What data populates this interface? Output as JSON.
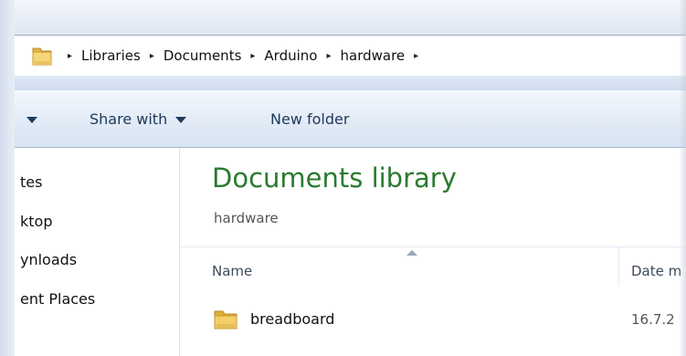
{
  "address_bar": {
    "breadcrumbs": [
      "Libraries",
      "Documents",
      "Arduino",
      "hardware"
    ],
    "separator": "▸"
  },
  "toolbar": {
    "organize_caret": "",
    "share_with_label": "Share with",
    "new_folder_label": "New folder"
  },
  "nav_pane": {
    "items": [
      "tes",
      "ktop",
      "ynloads",
      "ent Places"
    ]
  },
  "content": {
    "library_title": "Documents library",
    "library_subtitle": "hardware",
    "columns": [
      "Name",
      "Date m"
    ],
    "rows": [
      {
        "name": "breadboard",
        "date": "16.7.2"
      }
    ]
  },
  "colors": {
    "library_title": "#2a7a2f",
    "toolbar_text": "#1e395b",
    "folder": "#e8c35a"
  }
}
